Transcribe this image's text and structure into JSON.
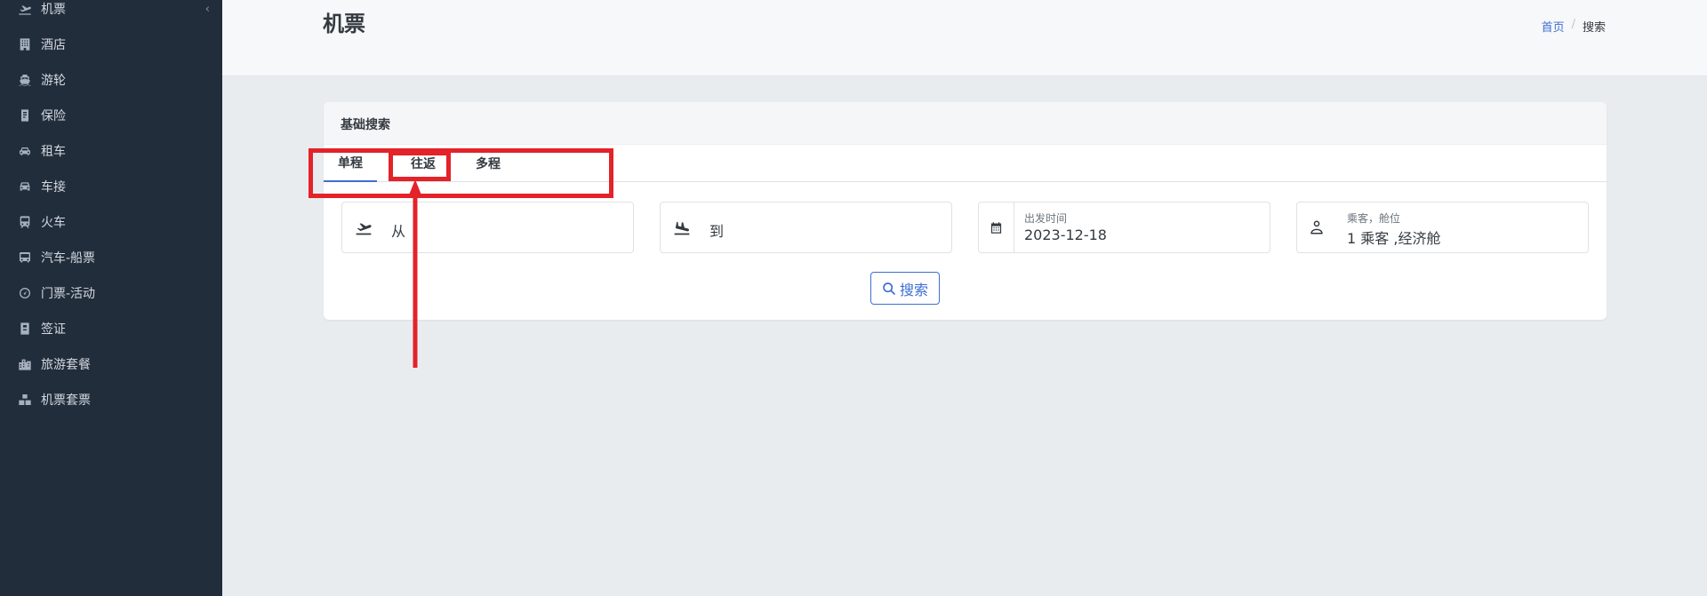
{
  "sidebar": {
    "collapse_icon": "chevron-left-icon",
    "items": [
      {
        "label": "机票",
        "icon": "plane-takeoff-icon"
      },
      {
        "label": "酒店",
        "icon": "hotel-building-icon"
      },
      {
        "label": "游轮",
        "icon": "ship-icon"
      },
      {
        "label": "保险",
        "icon": "document-icon"
      },
      {
        "label": "租车",
        "icon": "car-icon"
      },
      {
        "label": "车接",
        "icon": "car-front-icon"
      },
      {
        "label": "火车",
        "icon": "train-icon"
      },
      {
        "label": "汽车-船票",
        "icon": "bus-icon"
      },
      {
        "label": "门票-活动",
        "icon": "gauge-icon"
      },
      {
        "label": "签证",
        "icon": "passport-book-icon"
      },
      {
        "label": "旅游套餐",
        "icon": "city-icon"
      },
      {
        "label": "机票套票",
        "icon": "boxes-icon"
      }
    ]
  },
  "header": {
    "title": "机票",
    "breadcrumb": {
      "home": "首页",
      "current": "搜索"
    }
  },
  "search_card": {
    "title": "基础搜索",
    "tabs": [
      {
        "label": "单程",
        "active": true
      },
      {
        "label": "往返",
        "active": false
      },
      {
        "label": "多程",
        "active": false
      }
    ],
    "from": {
      "placeholder": "从",
      "icon": "plane-takeoff-icon"
    },
    "to": {
      "placeholder": "到",
      "icon": "plane-landing-icon"
    },
    "date": {
      "label": "出发时间",
      "value": "2023-12-18",
      "icon": "calendar-icon"
    },
    "passengers": {
      "label": "乘客，舱位",
      "value": "1 乘客 ,经济舱",
      "icon": "user-icon"
    },
    "search_button": {
      "label": "搜索",
      "icon": "search-icon"
    }
  },
  "colors": {
    "sidebar_bg": "#222d3c",
    "accent": "#3d6fd1",
    "annotation": "#e3222a"
  }
}
